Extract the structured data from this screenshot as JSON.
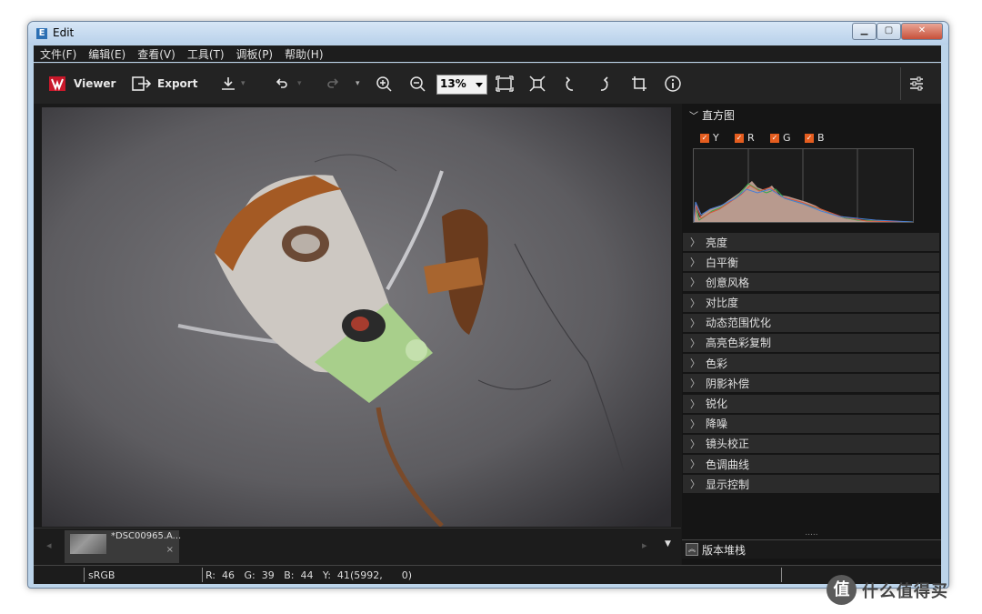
{
  "window": {
    "title": "Edit",
    "app_icon": "E"
  },
  "menu": [
    "文件(F)",
    "编辑(E)",
    "查看(V)",
    "工具(T)",
    "调板(P)",
    "帮助(H)"
  ],
  "toolbar": {
    "viewer_label": "Viewer",
    "export_label": "Export",
    "zoom_value": "13%"
  },
  "filmstrip": {
    "file_name": "*DSC00965.A...",
    "close": "×"
  },
  "panel": {
    "histogram_title": "直方图",
    "channels": [
      "Y",
      "R",
      "G",
      "B"
    ],
    "sections": [
      "亮度",
      "白平衡",
      "创意风格",
      "对比度",
      "动态范围优化",
      "高亮色彩复制",
      "色彩",
      "阴影补偿",
      "锐化",
      "降噪",
      "镜头校正",
      "色调曲线",
      "显示控制"
    ],
    "grip": ".....",
    "version_stack": "版本堆栈"
  },
  "status": {
    "color_space": "sRGB",
    "pixel_info": "R:  46   G:  39   B:  44   Y:  41",
    "coords": "(5992,      0)"
  },
  "watermark": {
    "logo": "值",
    "text": "什么值得买"
  },
  "colors": {
    "accent_checkbox": "#e55d1f",
    "panel_bg": "#151515",
    "section_bg": "#2b2b2b"
  }
}
